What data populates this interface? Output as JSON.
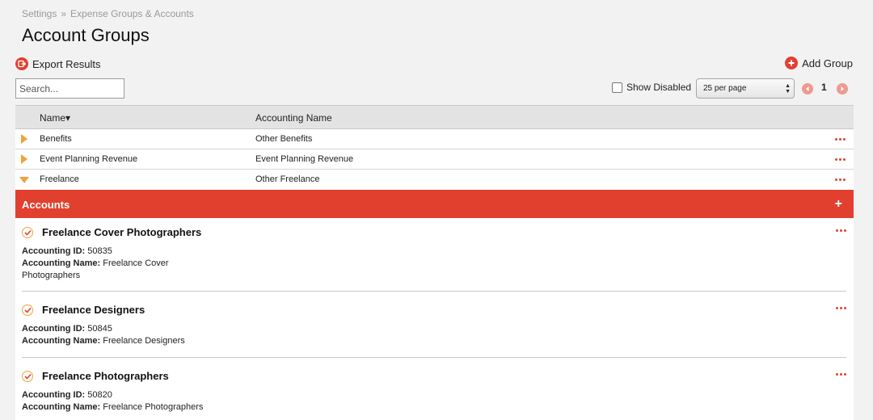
{
  "breadcrumb": {
    "root": "Settings",
    "sep": "»",
    "current": "Expense Groups & Accounts"
  },
  "page_title": "Account Groups",
  "actions": {
    "export_label": "Export Results",
    "add_label": "Add Group"
  },
  "search": {
    "placeholder": "Search..."
  },
  "filters": {
    "show_disabled_label": "Show Disabled",
    "per_page_value": "25 per page"
  },
  "pager": {
    "current_page": "1"
  },
  "table": {
    "columns": {
      "name": "Name▾",
      "accounting_name": "Accounting Name"
    },
    "rows": [
      {
        "name": "Benefits",
        "accounting_name": "Other Benefits",
        "expanded": false
      },
      {
        "name": "Event Planning Revenue",
        "accounting_name": "Event Planning Revenue",
        "expanded": false
      },
      {
        "name": "Freelance",
        "accounting_name": "Other Freelance",
        "expanded": true
      }
    ]
  },
  "accounts": {
    "header_label": "Accounts",
    "id_label": "Accounting ID:",
    "name_label": "Accounting Name:",
    "items": [
      {
        "title": "Freelance Cover Photographers",
        "accounting_id": "50835",
        "accounting_name": "Freelance Cover Photographers"
      },
      {
        "title": "Freelance Designers",
        "accounting_id": "50845",
        "accounting_name": "Freelance Designers"
      },
      {
        "title": "Freelance Photographers",
        "accounting_id": "50820",
        "accounting_name": "Freelance Photographers"
      }
    ]
  },
  "colors": {
    "accent": "#e2402f",
    "expander": "#f0a23c",
    "pager_inactive": "#ed9a90"
  }
}
